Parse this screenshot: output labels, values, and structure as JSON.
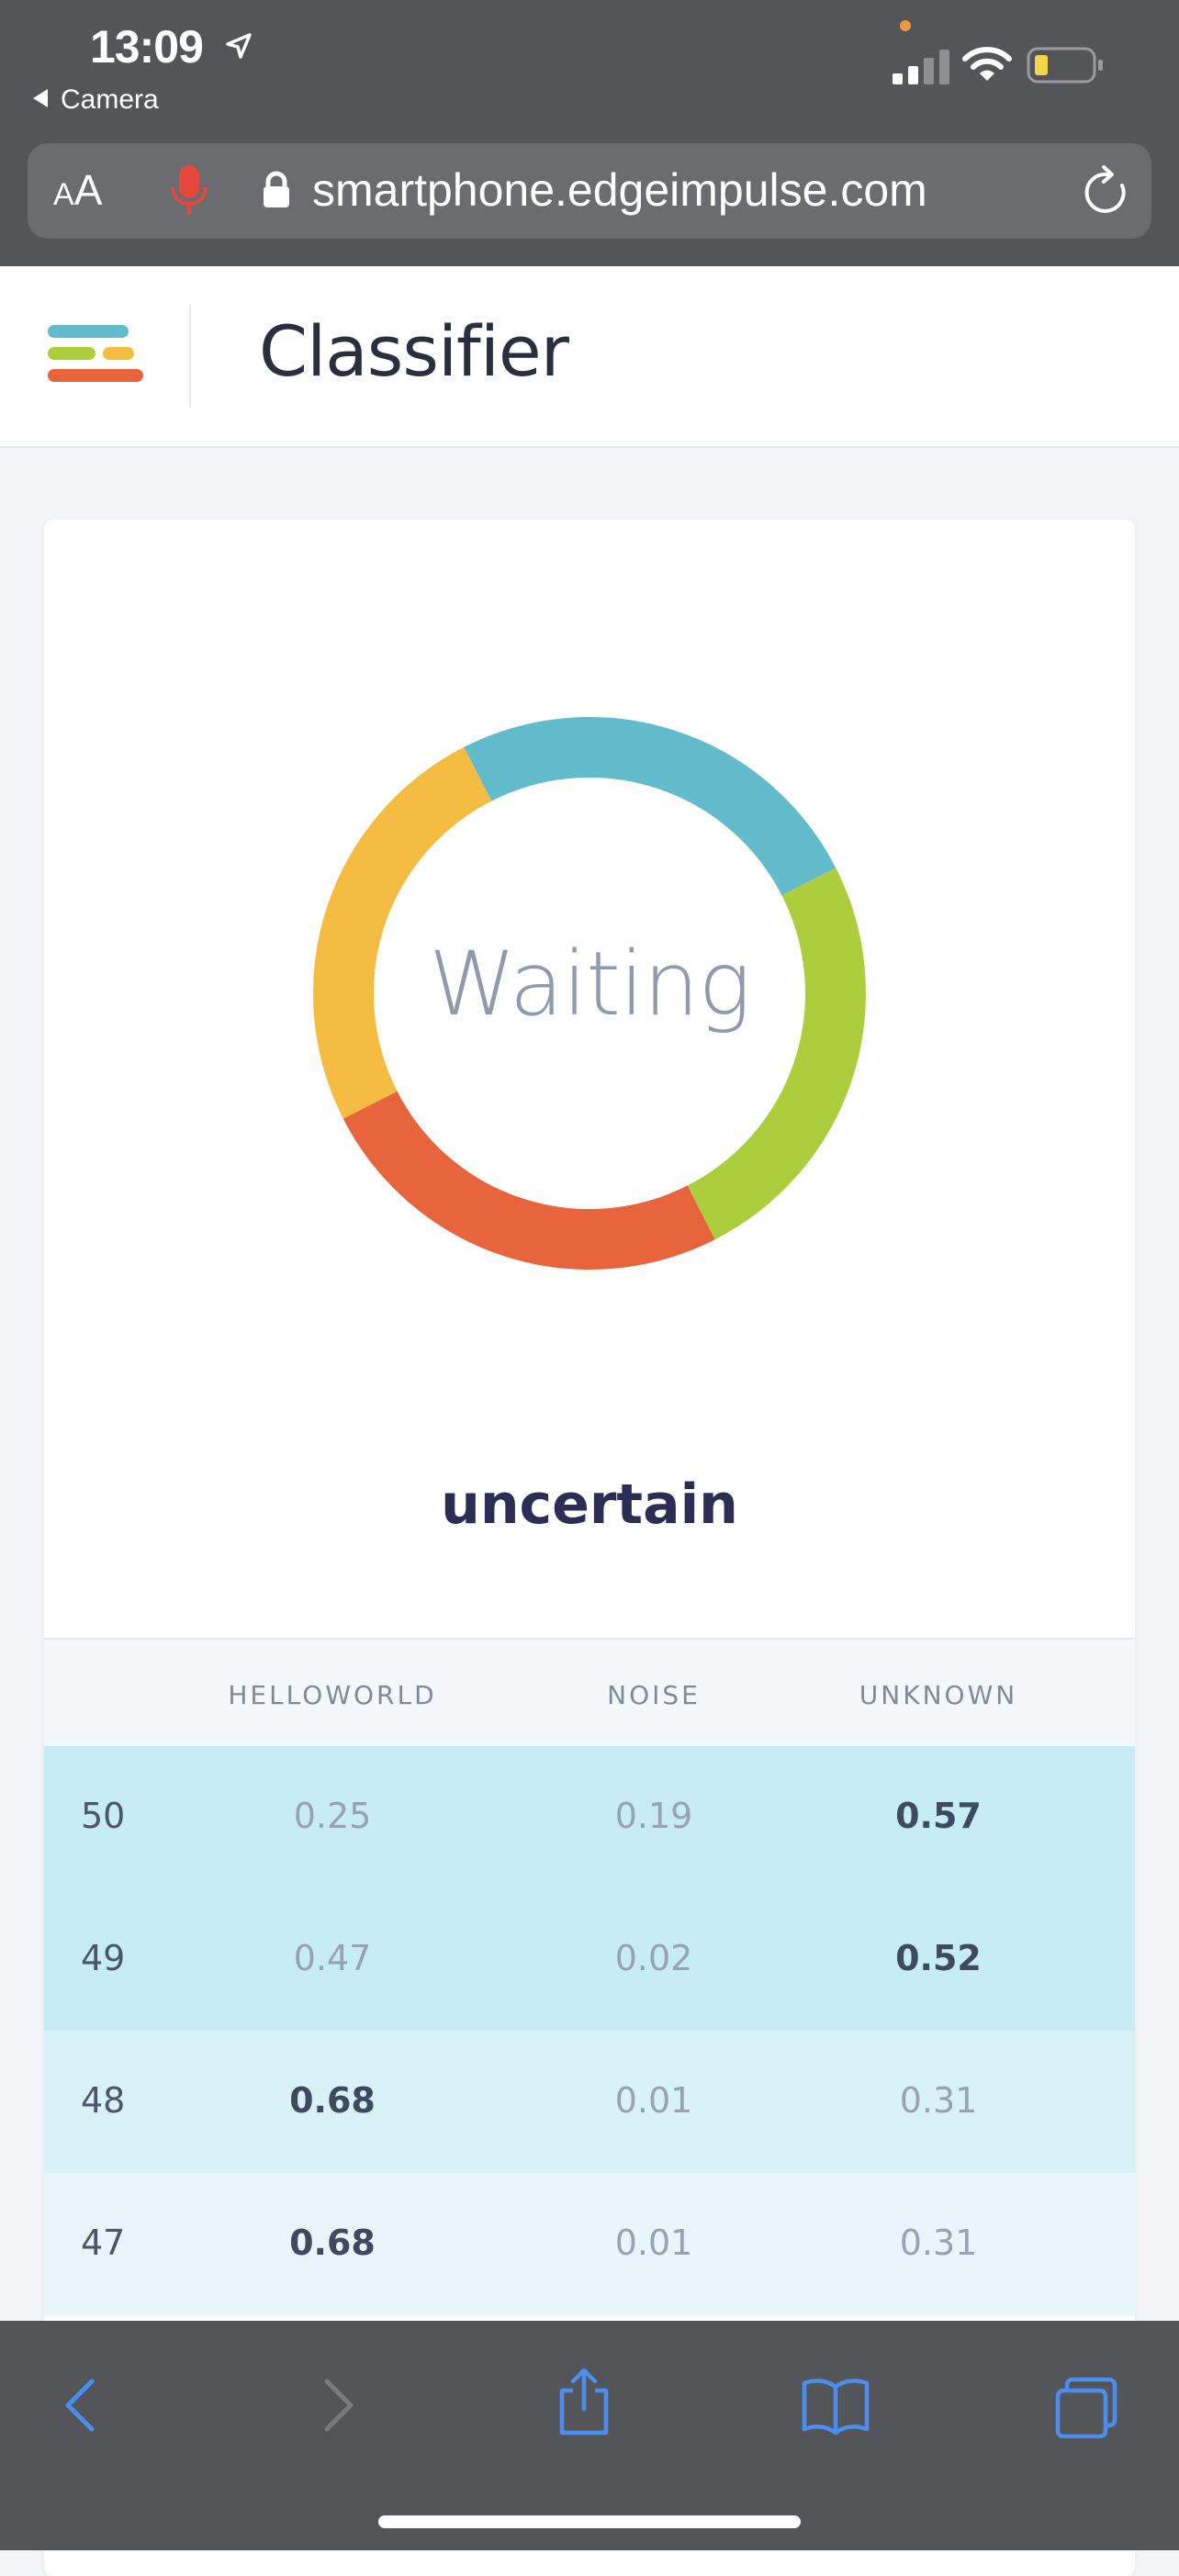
{
  "status_bar": {
    "time": "13:09",
    "back_app": "Camera"
  },
  "browser": {
    "text_size_label": "AA",
    "url": "smartphone.edgeimpulse.com"
  },
  "header": {
    "title": "Classifier"
  },
  "classifier": {
    "status": "Waiting",
    "result": "uncertain",
    "donut_colors": [
      "#f4bc41",
      "#62bccb",
      "#acce3c",
      "#e8643c"
    ]
  },
  "table": {
    "columns": [
      "",
      "HELLOWORLD",
      "NOISE",
      "UNKNOWN"
    ],
    "rows": [
      {
        "index": "50",
        "helloworld": "0.25",
        "noise": "0.19",
        "unknown": "0.57",
        "top": "unknown",
        "bg": "#c6ecf6"
      },
      {
        "index": "49",
        "helloworld": "0.47",
        "noise": "0.02",
        "unknown": "0.52",
        "top": "unknown",
        "bg": "#c6ecf6"
      },
      {
        "index": "48",
        "helloworld": "0.68",
        "noise": "0.01",
        "unknown": "0.31",
        "top": "helloworld",
        "bg": "#d8f2f7"
      },
      {
        "index": "47",
        "helloworld": "0.68",
        "noise": "0.01",
        "unknown": "0.31",
        "top": "helloworld",
        "bg": "#e7f6fb"
      }
    ]
  },
  "colors": {
    "accent": "#4a8ff0",
    "mic": "#e5483c"
  }
}
